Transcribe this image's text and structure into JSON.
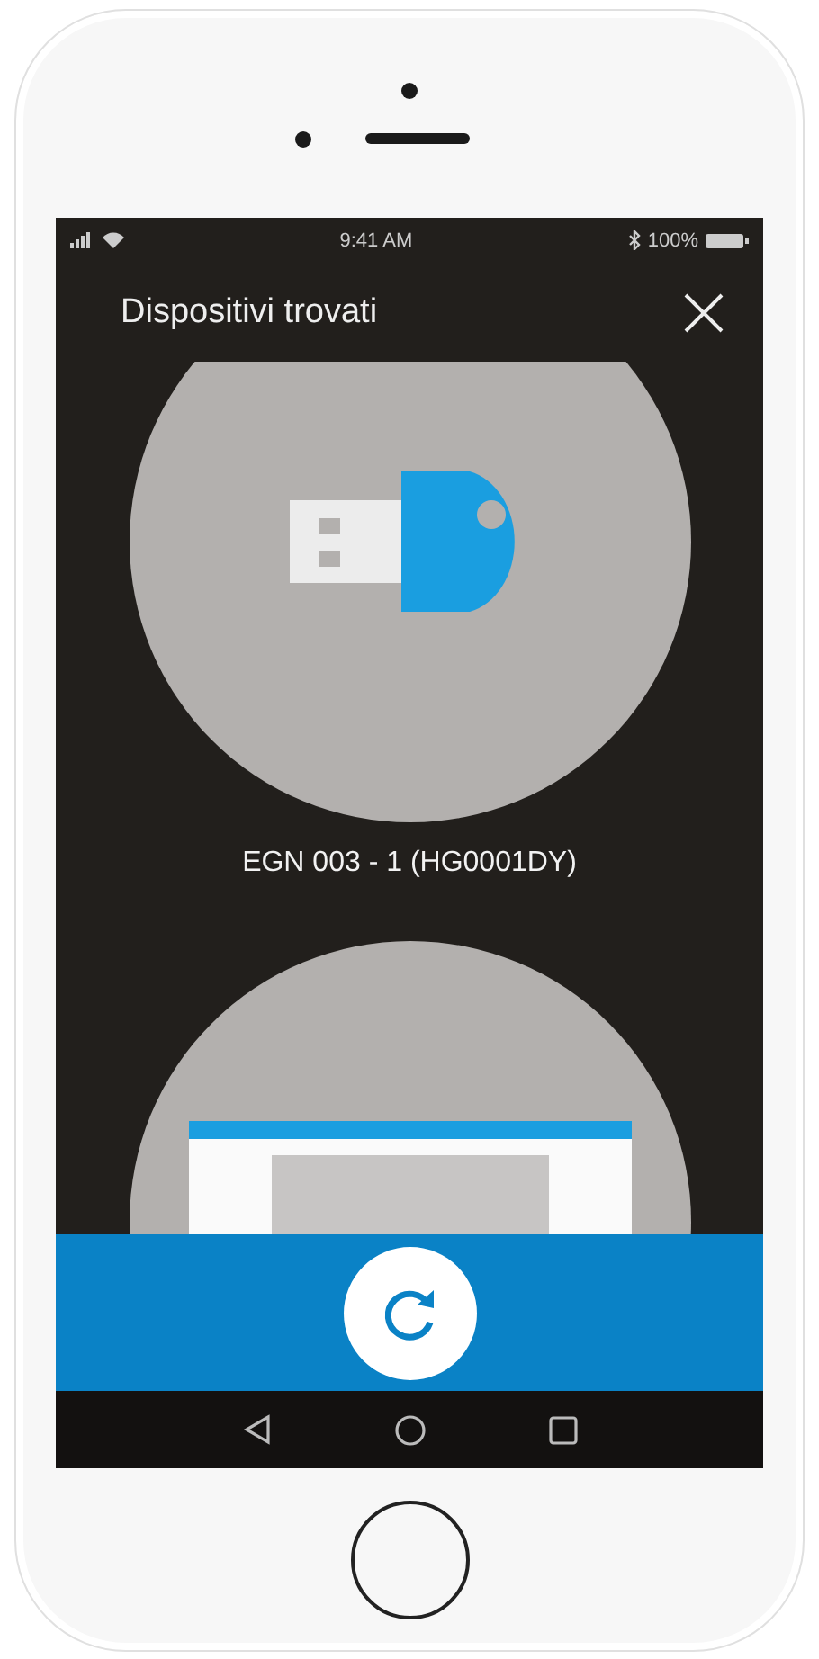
{
  "status_bar": {
    "time": "9:41 AM",
    "battery": "100%"
  },
  "header": {
    "title": "Dispositivi trovati"
  },
  "devices": [
    {
      "kind": "usb-key",
      "name": "EGN 003 - 1 (HG0001DY)"
    },
    {
      "kind": "card-reader"
    }
  ]
}
